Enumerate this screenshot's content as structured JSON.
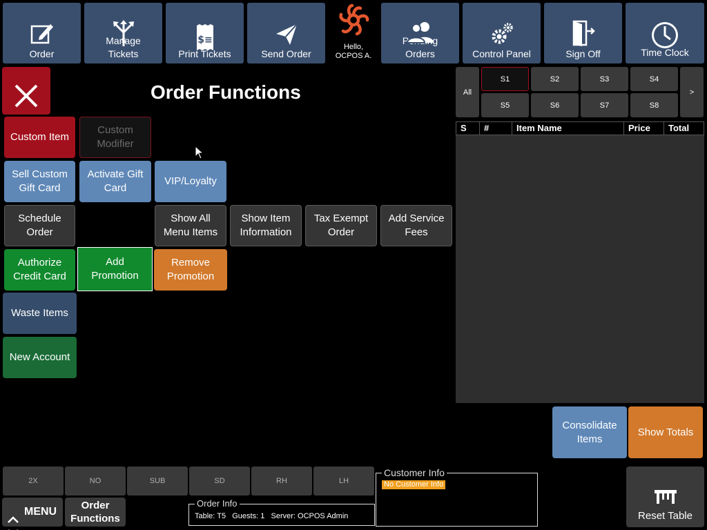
{
  "toolbar": {
    "order": "Order",
    "manage_tickets": "Manage\nTickets",
    "print_tickets": "Print Tickets",
    "send_order": "Send Order",
    "greeting": "Hello,\nOCPOS A.",
    "pending_orders": "Pending\nOrders",
    "control_panel": "Control Panel",
    "sign_off": "Sign Off",
    "time_clock": "Time Clock"
  },
  "panel": {
    "title": "Order Functions",
    "close": "close"
  },
  "functions": {
    "custom_item": "Custom Item",
    "custom_modifier": "Custom\nModifier",
    "sell_custom_gift_card": "Sell Custom\nGift Card",
    "activate_gift_card": "Activate Gift\nCard",
    "vip_loyalty": "VIP/Loyalty",
    "schedule_order": "Schedule\nOrder",
    "show_all_menu_items": "Show All\nMenu Items",
    "show_item_information": "Show Item\nInformation",
    "tax_exempt_order": "Tax Exempt\nOrder",
    "add_service_fees": "Add Service\nFees",
    "authorize_credit_card": "Authorize\nCredit Card",
    "add_promotion": "Add\nPromotion",
    "remove_promotion": "Remove\nPromotion",
    "waste_items": "Waste Items",
    "new_account": "New Account"
  },
  "seats": {
    "all": "All",
    "next": ">",
    "items": [
      "S1",
      "S2",
      "S3",
      "S4",
      "S5",
      "S6",
      "S7",
      "S8"
    ],
    "selected": "S1"
  },
  "table": {
    "columns": [
      "S",
      "#",
      "Item Name",
      "Price",
      "Total"
    ]
  },
  "actions": {
    "consolidate_items": "Consolidate\nItems",
    "show_totals": "Show Totals",
    "reset_table": "Reset Table"
  },
  "modifiers": [
    "2X",
    "NO",
    "SUB",
    "SD",
    "RH",
    "LH"
  ],
  "bottom": {
    "menu": "MENU",
    "order_functions": "Order\nFunctions"
  },
  "customer_info": {
    "legend": "Customer Info",
    "status": "No Customer Info",
    "status_color": "#f0a020"
  },
  "order_info": {
    "legend": "Order Info",
    "table_label": "Table:",
    "table_value": "T5",
    "guests_label": "Guests:",
    "guests_value": "1",
    "server_label": "Server:",
    "server_value": "OCPOS Admin"
  },
  "colors": {
    "toolbar": "#3a4f6e",
    "red": "#a3101d",
    "blue": "#5f88b7",
    "green": "#118a2e",
    "orange": "#d2792b"
  }
}
